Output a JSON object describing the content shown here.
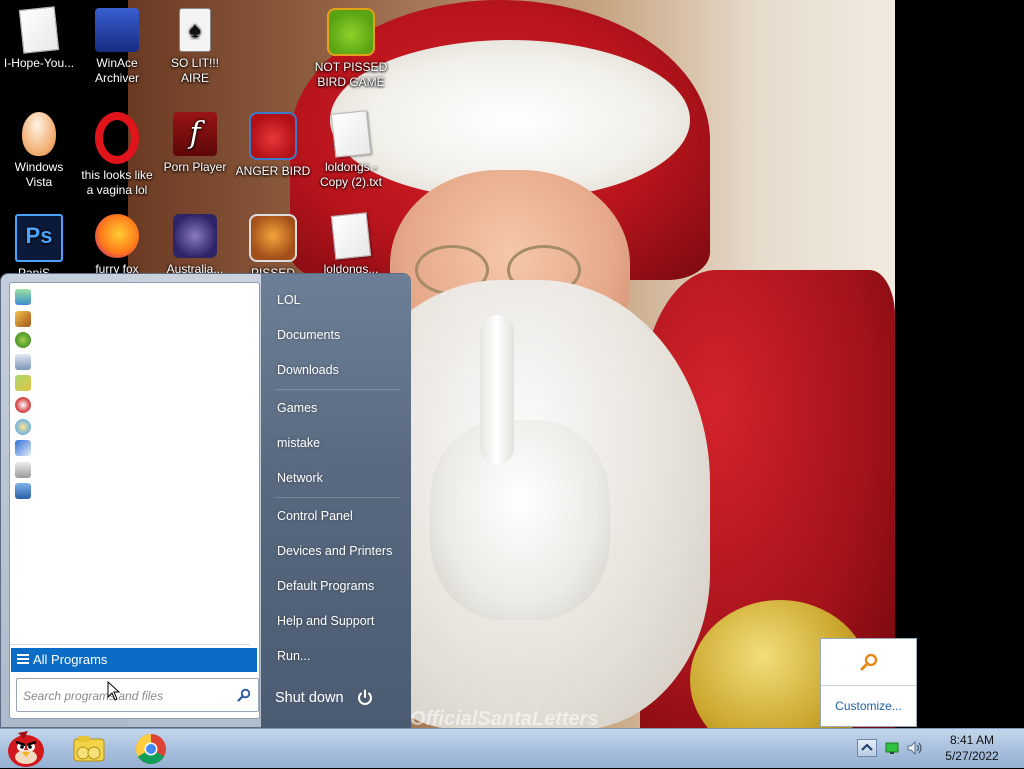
{
  "desktop": {
    "icons": [
      {
        "label": "I-Hope-You...",
        "icon": "text-file-icon"
      },
      {
        "label": "WinAce Archiver",
        "icon": "winace-icon"
      },
      {
        "label": "SO LIT!!! AIRE",
        "icon": "solitaire-icon"
      },
      {
        "label": "NOT PISSED BIRD GAME",
        "icon": "bad-piggies-icon"
      },
      {
        "label": "Windows Vista",
        "icon": "egg-icon"
      },
      {
        "label": "this looks like a vagina lol",
        "icon": "opera-icon"
      },
      {
        "label": "Porn Player",
        "icon": "flash-player-icon"
      },
      {
        "label": "ANGER BIRD",
        "icon": "angry-birds-icon"
      },
      {
        "label": "loldongs - Copy (2).txt",
        "icon": "text-file-icon"
      },
      {
        "label": "PaniS...",
        "icon": "photoshop-icon"
      },
      {
        "label": "furry fox",
        "icon": "firefox-icon"
      },
      {
        "label": "Australia...",
        "icon": "spider-solitaire-icon"
      },
      {
        "label": "PISSED OFF...",
        "icon": "angry-birds-seasons-icon"
      },
      {
        "label": "loldongs...",
        "icon": "text-file-icon"
      }
    ],
    "wallpaper_watermark": "OfficialSantaLetters"
  },
  "start_menu": {
    "recent_programs": [
      "program-1-icon",
      "program-2-icon",
      "program-3-icon",
      "program-4-icon",
      "program-5-icon",
      "program-6-icon",
      "program-7-icon",
      "program-8-icon",
      "program-9-icon",
      "program-10-icon"
    ],
    "all_programs_label": "All Programs",
    "search_placeholder": "Search programs and files",
    "right_links": [
      "LOL",
      "Documents",
      "Downloads",
      "Games",
      "mistake",
      "Network",
      "Control Panel",
      "Devices and Printers",
      "Default Programs",
      "Help and Support",
      "Run..."
    ],
    "shutdown_label": "Shut down"
  },
  "tray_popup": {
    "customize_label": "Customize..."
  },
  "taskbar": {
    "pinned": [
      "angry-birds-start-orb",
      "file-explorer-icon",
      "chrome-icon"
    ],
    "clock": {
      "time": "8:41 AM",
      "date": "5/27/2022"
    }
  },
  "colors": {
    "selection_blue": "#0b6cc6",
    "start_menu_right": "#5a6b82",
    "taskbar": "#a9c1de"
  }
}
